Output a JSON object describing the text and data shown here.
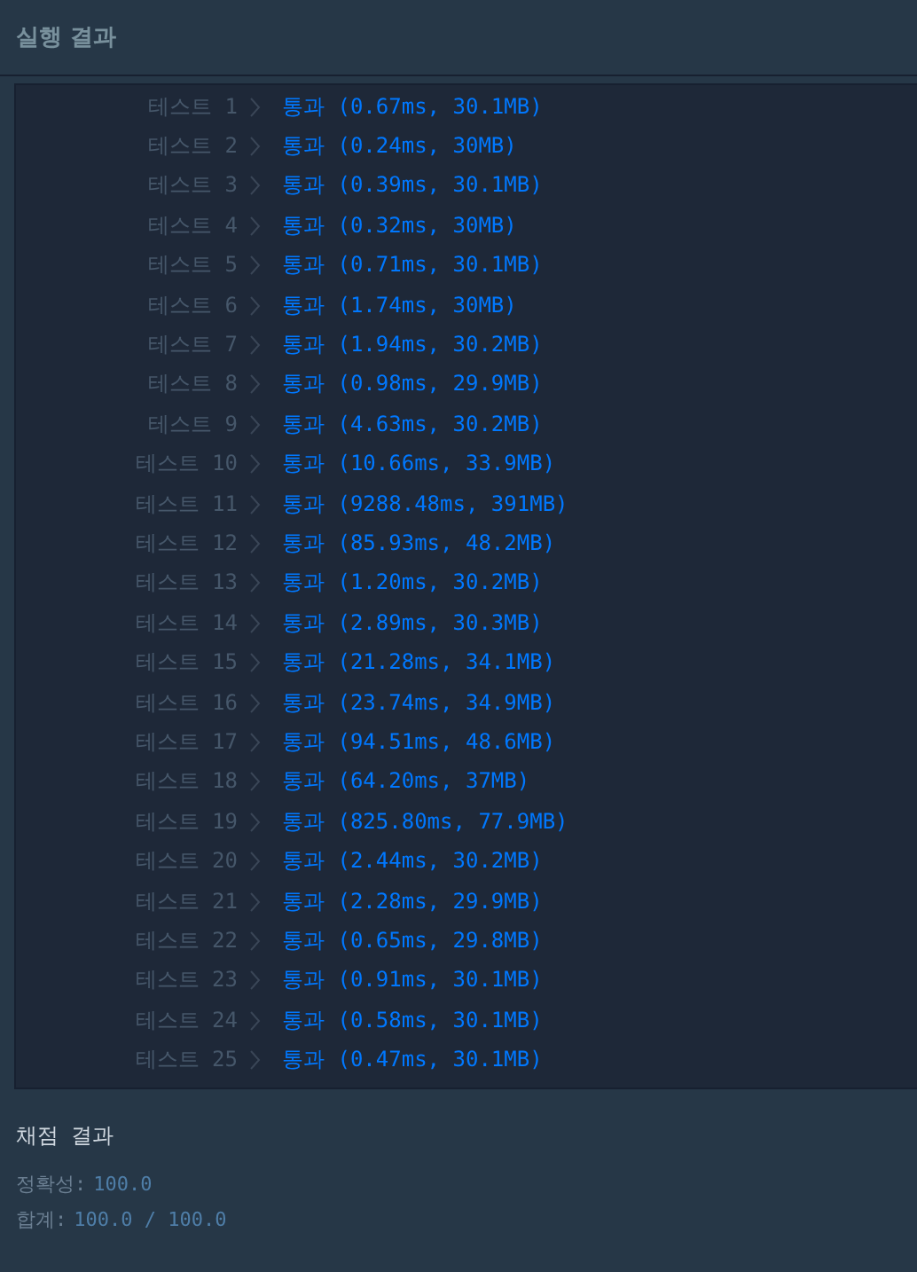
{
  "header": {
    "title": "실행 결과"
  },
  "tests": [
    {
      "label": "테스트 1",
      "result": "통과 (0.67ms, 30.1MB)"
    },
    {
      "label": "테스트 2",
      "result": "통과 (0.24ms, 30MB)"
    },
    {
      "label": "테스트 3",
      "result": "통과 (0.39ms, 30.1MB)"
    },
    {
      "label": "테스트 4",
      "result": "통과 (0.32ms, 30MB)"
    },
    {
      "label": "테스트 5",
      "result": "통과 (0.71ms, 30.1MB)"
    },
    {
      "label": "테스트 6",
      "result": "통과 (1.74ms, 30MB)"
    },
    {
      "label": "테스트 7",
      "result": "통과 (1.94ms, 30.2MB)"
    },
    {
      "label": "테스트 8",
      "result": "통과 (0.98ms, 29.9MB)"
    },
    {
      "label": "테스트 9",
      "result": "통과 (4.63ms, 30.2MB)"
    },
    {
      "label": "테스트 10",
      "result": "통과 (10.66ms, 33.9MB)"
    },
    {
      "label": "테스트 11",
      "result": "통과 (9288.48ms, 391MB)"
    },
    {
      "label": "테스트 12",
      "result": "통과 (85.93ms, 48.2MB)"
    },
    {
      "label": "테스트 13",
      "result": "통과 (1.20ms, 30.2MB)"
    },
    {
      "label": "테스트 14",
      "result": "통과 (2.89ms, 30.3MB)"
    },
    {
      "label": "테스트 15",
      "result": "통과 (21.28ms, 34.1MB)"
    },
    {
      "label": "테스트 16",
      "result": "통과 (23.74ms, 34.9MB)"
    },
    {
      "label": "테스트 17",
      "result": "통과 (94.51ms, 48.6MB)"
    },
    {
      "label": "테스트 18",
      "result": "통과 (64.20ms, 37MB)"
    },
    {
      "label": "테스트 19",
      "result": "통과 (825.80ms, 77.9MB)"
    },
    {
      "label": "테스트 20",
      "result": "통과 (2.44ms, 30.2MB)"
    },
    {
      "label": "테스트 21",
      "result": "통과 (2.28ms, 29.9MB)"
    },
    {
      "label": "테스트 22",
      "result": "통과 (0.65ms, 29.8MB)"
    },
    {
      "label": "테스트 23",
      "result": "통과 (0.91ms, 30.1MB)"
    },
    {
      "label": "테스트 24",
      "result": "통과 (0.58ms, 30.1MB)"
    },
    {
      "label": "테스트 25",
      "result": "통과 (0.47ms, 30.1MB)"
    }
  ],
  "summary": {
    "title": "채점 결과",
    "lines": [
      {
        "label": "정확성:",
        "value": "100.0"
      },
      {
        "label": "합계:",
        "value": "100.0 / 100.0"
      }
    ]
  }
}
